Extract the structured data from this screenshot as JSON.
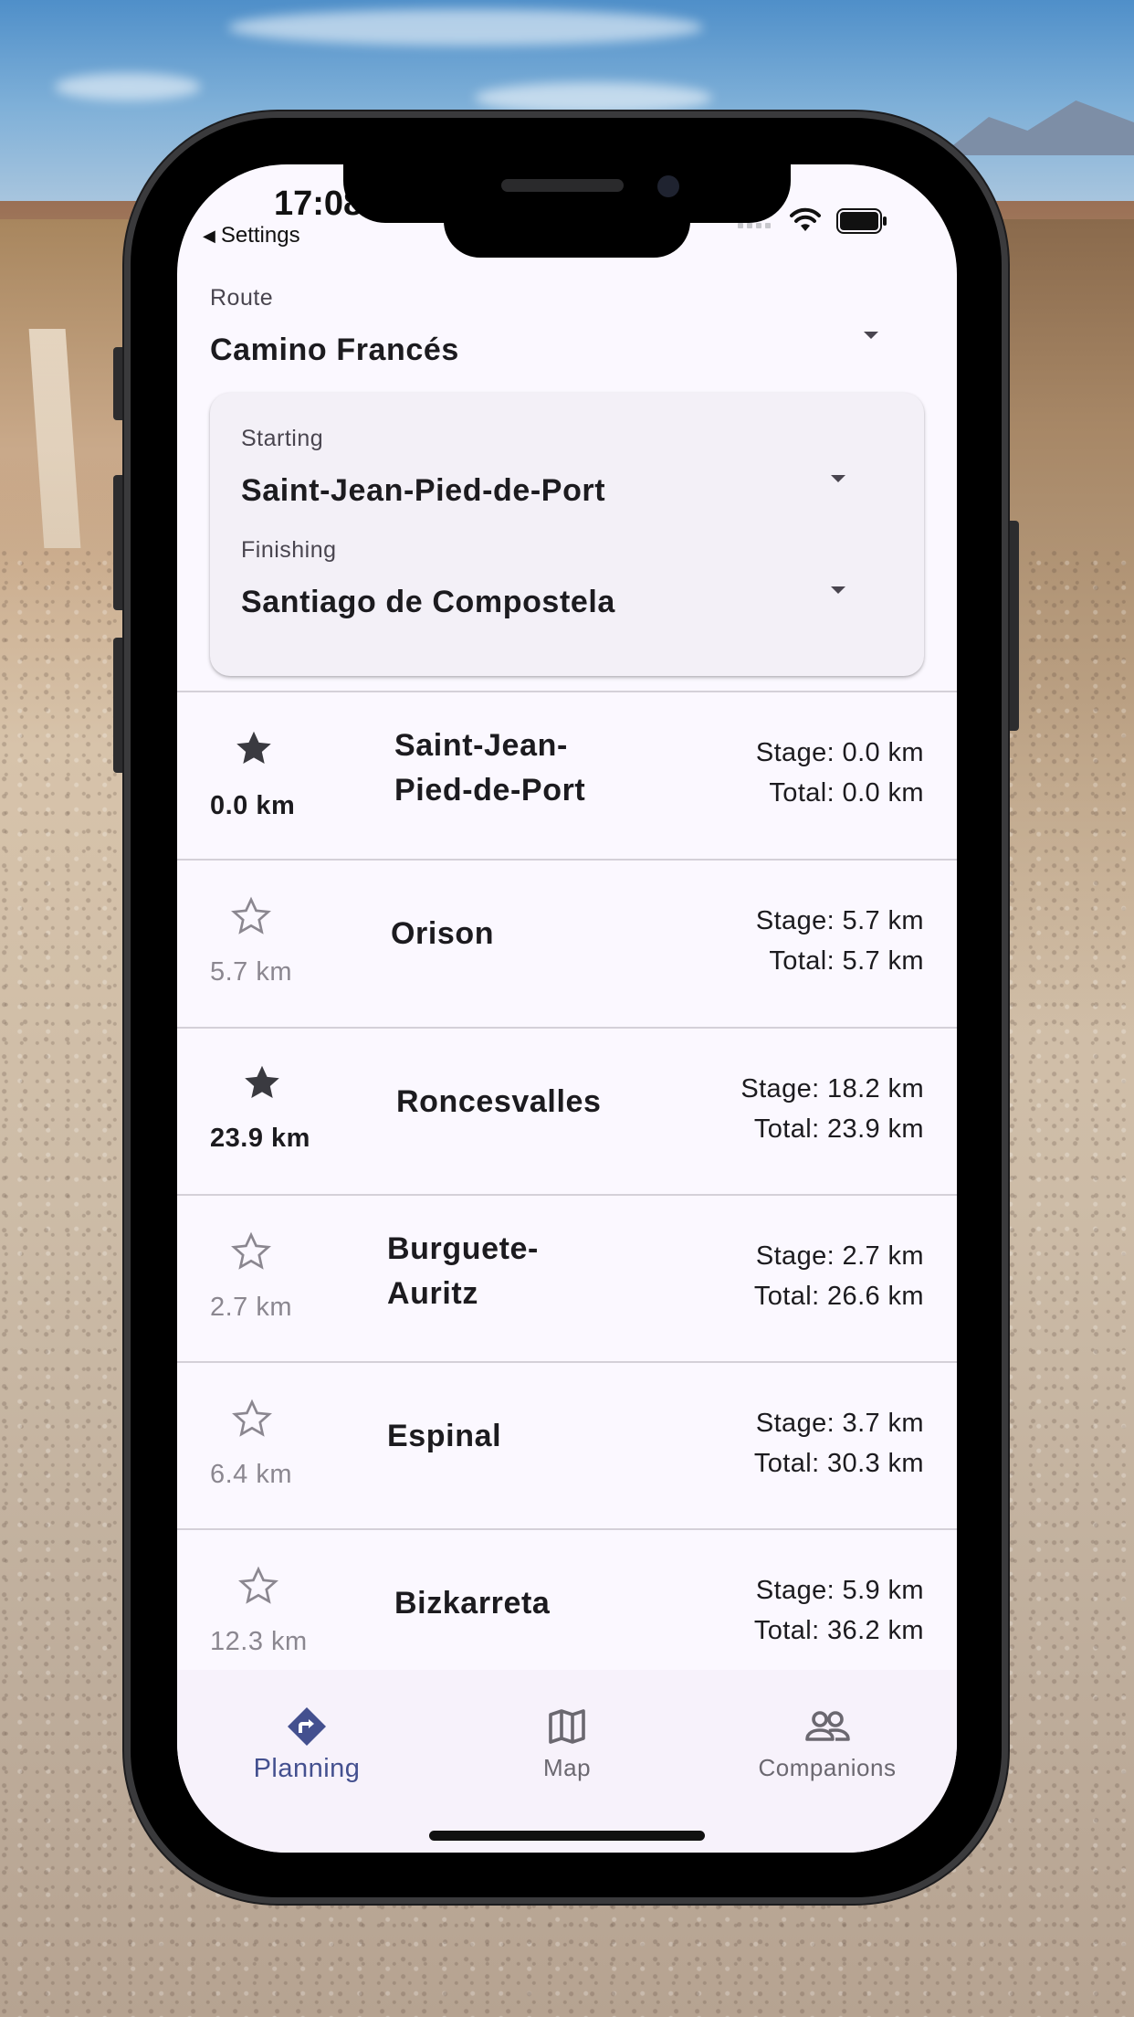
{
  "status_bar": {
    "time": "17:08",
    "back_label": "Settings"
  },
  "route": {
    "label": "Route",
    "value": "Camino Francés"
  },
  "starting": {
    "label": "Starting",
    "value": "Saint-Jean-Pied-de-Port"
  },
  "finishing": {
    "label": "Finishing",
    "value": "Santiago de Compostela"
  },
  "stops": [
    {
      "name_line1": "Saint-Jean-",
      "name_line2": "Pied-de-Port",
      "distance": "0.0 km",
      "starred": true,
      "stage": "Stage: 0.0 km",
      "total": "Total: 0.0 km"
    },
    {
      "name_line1": "Orison",
      "name_line2": "",
      "distance": "5.7 km",
      "starred": false,
      "stage": "Stage: 5.7 km",
      "total": "Total: 5.7 km"
    },
    {
      "name_line1": "Roncesvalles",
      "name_line2": "",
      "distance": "23.9 km",
      "starred": true,
      "stage": "Stage: 18.2 km",
      "total": "Total: 23.9 km"
    },
    {
      "name_line1": "Burguete-",
      "name_line2": "Auritz",
      "distance": "2.7 km",
      "starred": false,
      "stage": "Stage: 2.7 km",
      "total": "Total: 26.6 km"
    },
    {
      "name_line1": "Espinal",
      "name_line2": "",
      "distance": "6.4 km",
      "starred": false,
      "stage": "Stage: 3.7 km",
      "total": "Total: 30.3 km"
    },
    {
      "name_line1": "Bizkarreta",
      "name_line2": "",
      "distance": "12.3 km",
      "starred": false,
      "stage": "Stage: 5.9 km",
      "total": "Total: 36.2 km"
    }
  ],
  "nav": {
    "planning": "Planning",
    "map": "Map",
    "companions": "Companions",
    "active": "planning"
  },
  "colors": {
    "accent": "#44508f",
    "screen_bg": "#fbf8ff",
    "card_bg": "#f3f0f7"
  }
}
